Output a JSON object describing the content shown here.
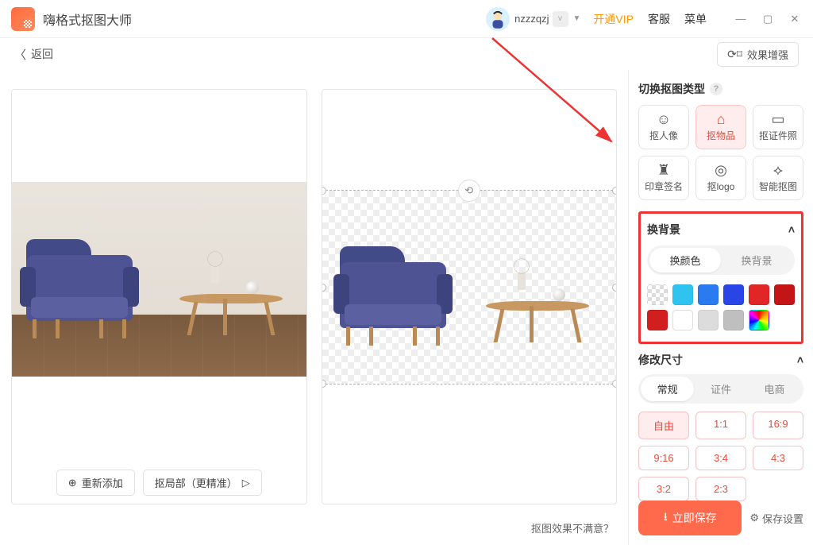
{
  "titlebar": {
    "app_name": "嗨格式抠图大师",
    "username": "nzzzqzj",
    "vip_link": "开通VIP",
    "support": "客服",
    "menu": "菜单"
  },
  "secondbar": {
    "back": "返回",
    "enhance": "效果增强"
  },
  "left_actions": {
    "readd": "重新添加",
    "partial": "抠局部（更精准）"
  },
  "footer": {
    "feedback": "抠图效果不满意？"
  },
  "panel": {
    "type_title": "切换抠图类型",
    "types": [
      "抠人像",
      "抠物品",
      "抠证件照",
      "印章签名",
      "抠logo",
      "智能抠图"
    ],
    "bg_section": "换背景",
    "bg_tabs": [
      "换颜色",
      "换背景"
    ],
    "swatches": [
      "transparent",
      "#2fc4f0",
      "#2a7af0",
      "#2a45e6",
      "#e02626",
      "#c31515",
      "#d11f1f",
      "#ffffff",
      "#dcdcdc",
      "#bfbfbf",
      "rainbow"
    ],
    "size_section": "修改尺寸",
    "size_tabs": [
      "常规",
      "证件",
      "电商"
    ],
    "ratios": [
      "自由",
      "1:1",
      "16:9",
      "9:16",
      "3:4",
      "4:3",
      "3:2",
      "2:3"
    ],
    "save": "立即保存",
    "save_settings": "保存设置"
  }
}
